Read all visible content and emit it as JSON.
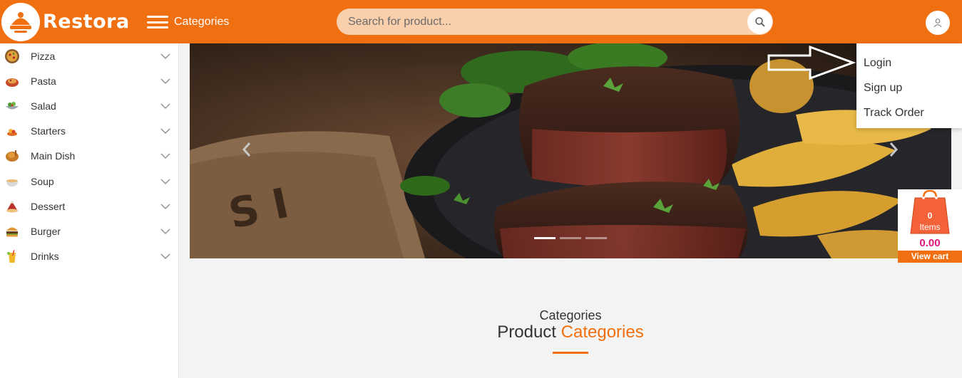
{
  "header": {
    "brand": "Restora",
    "categories_label": "Categories",
    "search_placeholder": "Search for product..."
  },
  "sidebar": {
    "items": [
      {
        "label": "Pizza",
        "icon": "pizza-icon"
      },
      {
        "label": "Pasta",
        "icon": "pasta-icon"
      },
      {
        "label": "Salad",
        "icon": "salad-icon"
      },
      {
        "label": "Starters",
        "icon": "starters-icon"
      },
      {
        "label": "Main Dish",
        "icon": "main-dish-icon"
      },
      {
        "label": "Soup",
        "icon": "soup-icon"
      },
      {
        "label": "Dessert",
        "icon": "dessert-icon"
      },
      {
        "label": "Burger",
        "icon": "burger-icon"
      },
      {
        "label": "Drinks",
        "icon": "drinks-icon"
      }
    ]
  },
  "user_menu": {
    "items": [
      "Login",
      "Sign up",
      "Track Order"
    ]
  },
  "carousel": {
    "slides": 3,
    "active_slide": 1
  },
  "cart": {
    "count": "0",
    "items_label": "Items",
    "total": "0.00",
    "view_label": "View cart"
  },
  "section": {
    "subtitle": "Categories",
    "title_main": "Product",
    "title_accent": "Categories"
  },
  "colors": {
    "brand_orange": "#f07011",
    "search_bg": "#f9cfac",
    "cart_total": "#e0187a"
  }
}
